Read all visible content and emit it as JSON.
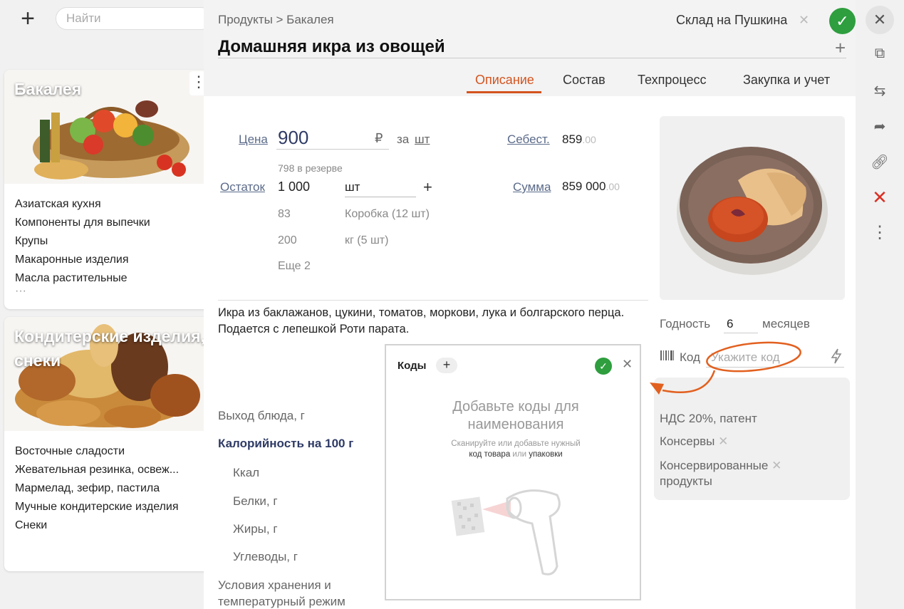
{
  "search": {
    "placeholder": "Найти"
  },
  "left_cards": [
    {
      "title": "Бакалея",
      "items": [
        "Азиатская кухня",
        "Компоненты для выпечки",
        "Крупы",
        "Макаронные изделия",
        "Масла растительные"
      ]
    },
    {
      "title_line1": "Кондитерские изделия,",
      "title_line2": "снеки",
      "items": [
        "Восточные сладости",
        "Жевательная резинка, освеж...",
        "Мармелад, зефир, пастила",
        "Мучные кондитерские изделия",
        "Снеки"
      ]
    }
  ],
  "header": {
    "breadcrumb": "Продукты > Бакалея",
    "title": "Домашняя икра из овощей",
    "store": "Склад на Пушкина"
  },
  "tabs": [
    "Описание",
    "Состав",
    "Техпроцесс",
    "Закупка и учет"
  ],
  "pricing": {
    "price_label": "Цена",
    "price_value": "900",
    "currency": "₽",
    "per": "за",
    "per_unit": "шт",
    "cost_label": "Себест.",
    "cost_value": "859",
    "cost_cents": ".00",
    "reserve": "798 в резерве",
    "stock_label": "Остаток",
    "stock_value": "1 000",
    "stock_unit": "шт",
    "sum_label": "Сумма",
    "sum_value": "859 000",
    "sum_cents": ".00",
    "packs": [
      {
        "qty": "83",
        "unit": "Коробка (12 шт)"
      },
      {
        "qty": "200",
        "unit": "кг (5 шт)"
      }
    ],
    "more": "Еще 2"
  },
  "description": "Икра из баклажанов, цукини, томатов, моркови, лука и болгарского перца. Подается с лепешкой Роти парата.",
  "nutrition": {
    "output": "Выход блюда, г",
    "calories_header": "Калорийность на 100 г",
    "kcal": "Ккал",
    "proteins": "Белки, г",
    "fats": "Жиры, г",
    "carbs": "Углеводы, г",
    "storage_line1": "Условия хранения и",
    "storage_line2": "температурный режим"
  },
  "codes_popup": {
    "title": "Коды",
    "empty_line1": "Добавьте коды для",
    "empty_line2": "наименования",
    "hint_1": "Сканируйте или добавьте нужный",
    "hint_2a": "код товара",
    "hint_2b": " или ",
    "hint_2c": "упаковки"
  },
  "side": {
    "shelf_label": "Годность",
    "shelf_value": "6",
    "shelf_unit": "месяцев",
    "code_label": "Код",
    "code_placeholder": "Укажите код",
    "tags": [
      "НДС 20%, патент",
      "Консервы",
      "Консервированные",
      "продукты"
    ]
  },
  "colors": {
    "accent": "#d4541f",
    "ok": "#2e9e3e",
    "navy": "#2f3b66",
    "delete": "#d93025"
  }
}
